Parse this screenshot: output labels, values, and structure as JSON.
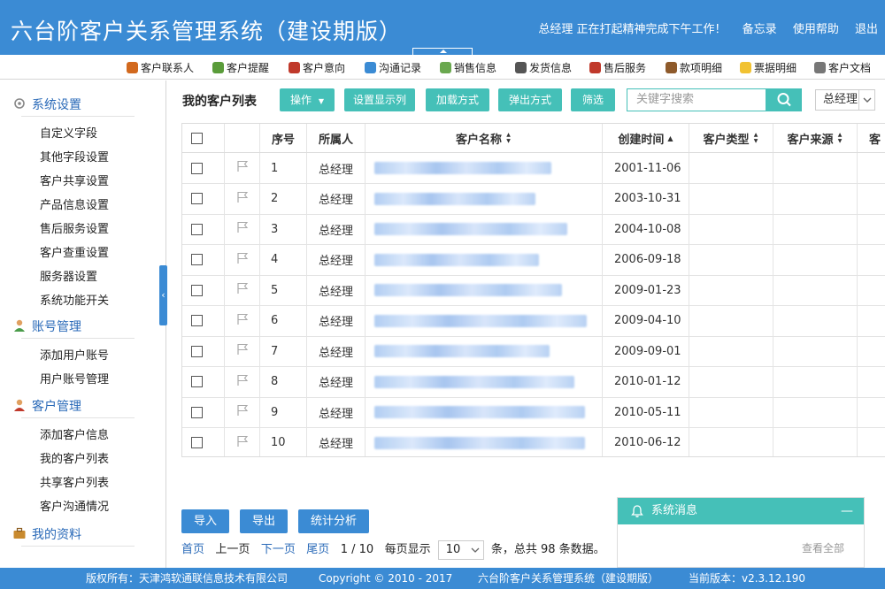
{
  "header": {
    "title": "六台阶客户关系管理系统（建设期版）",
    "greeting": "总经理  正在打起精神完成下午工作！",
    "memo": "备忘录",
    "help": "使用帮助",
    "logout": "退出"
  },
  "toolbar": [
    {
      "label": "客户联系人",
      "icon": "contact-icon",
      "color": "#d2691e"
    },
    {
      "label": "客户提醒",
      "icon": "alarm-clock-icon",
      "color": "#5a9c3a"
    },
    {
      "label": "客户意向",
      "icon": "person-icon",
      "color": "#c0392b"
    },
    {
      "label": "沟通记录",
      "icon": "chat-icon",
      "color": "#3b8bd4"
    },
    {
      "label": "销售信息",
      "icon": "sales-icon",
      "color": "#6aa84f"
    },
    {
      "label": "发货信息",
      "icon": "truck-icon",
      "color": "#555555"
    },
    {
      "label": "售后服务",
      "icon": "service-person-icon",
      "color": "#c0392b"
    },
    {
      "label": "款项明细",
      "icon": "money-icon",
      "color": "#8e5a2b"
    },
    {
      "label": "票据明细",
      "icon": "bill-icon",
      "color": "#f1c232"
    },
    {
      "label": "客户文档",
      "icon": "document-icon",
      "color": "#777777"
    }
  ],
  "sidebar": {
    "groups": [
      {
        "label": "系统设置",
        "icon": "gear-icon",
        "items": [
          "自定义字段",
          "其他字段设置",
          "客户共享设置",
          "产品信息设置",
          "售后服务设置",
          "客户查重设置",
          "服务器设置",
          "系统功能开关"
        ]
      },
      {
        "label": "账号管理",
        "icon": "user-account-icon",
        "items": [
          "添加用户账号",
          "用户账号管理"
        ]
      },
      {
        "label": "客户管理",
        "icon": "customer-icon",
        "items": [
          "添加客户信息",
          "我的客户列表",
          "共享客户列表",
          "客户沟通情况"
        ]
      },
      {
        "label": "我的资料",
        "icon": "briefcase-icon",
        "items": []
      }
    ]
  },
  "main": {
    "title": "我的客户列表",
    "buttons": {
      "operate": "操作",
      "display_cols": "设置显示列",
      "load_mode": "加载方式",
      "popup_mode": "弹出方式",
      "filter": "筛选"
    },
    "search_placeholder": "关键字搜索",
    "owner_select": "总经理",
    "columns": [
      "序号",
      "所属人",
      "客户名称",
      "创建时间",
      "客户类型",
      "客户来源",
      "客"
    ],
    "rows": [
      {
        "no": "1",
        "owner": "总经理",
        "date": "2001-11-06"
      },
      {
        "no": "2",
        "owner": "总经理",
        "date": "2003-10-31"
      },
      {
        "no": "3",
        "owner": "总经理",
        "date": "2004-10-08"
      },
      {
        "no": "4",
        "owner": "总经理",
        "date": "2006-09-18"
      },
      {
        "no": "5",
        "owner": "总经理",
        "date": "2009-01-23"
      },
      {
        "no": "6",
        "owner": "总经理",
        "date": "2009-04-10"
      },
      {
        "no": "7",
        "owner": "总经理",
        "date": "2009-09-01"
      },
      {
        "no": "8",
        "owner": "总经理",
        "date": "2010-01-12"
      },
      {
        "no": "9",
        "owner": "总经理",
        "date": "2010-05-11"
      },
      {
        "no": "10",
        "owner": "总经理",
        "date": "2010-06-12"
      }
    ],
    "actions": {
      "import": "导入",
      "export": "导出",
      "stats": "统计分析"
    },
    "pager": {
      "first": "首页",
      "prev": "上一页",
      "next": "下一页",
      "last": "尾页",
      "page": "1 / 10",
      "per_page_label": "每页显示",
      "per_page": "10",
      "total": "条，总共 98 条数据。"
    }
  },
  "messages": {
    "title": "系统消息",
    "view_all": "查看全部"
  },
  "status": {
    "copyright_owner": "版权所有：天津鸿软通联信息技术有限公司",
    "copyright": "Copyright © 2010 - 2017",
    "product": "六台阶客户关系管理系统（建设期版）",
    "version": "当前版本：v2.3.12.190"
  },
  "colors": {
    "header": "#3b8bd4",
    "accent": "#45c0b8",
    "link": "#2a6ab8"
  }
}
